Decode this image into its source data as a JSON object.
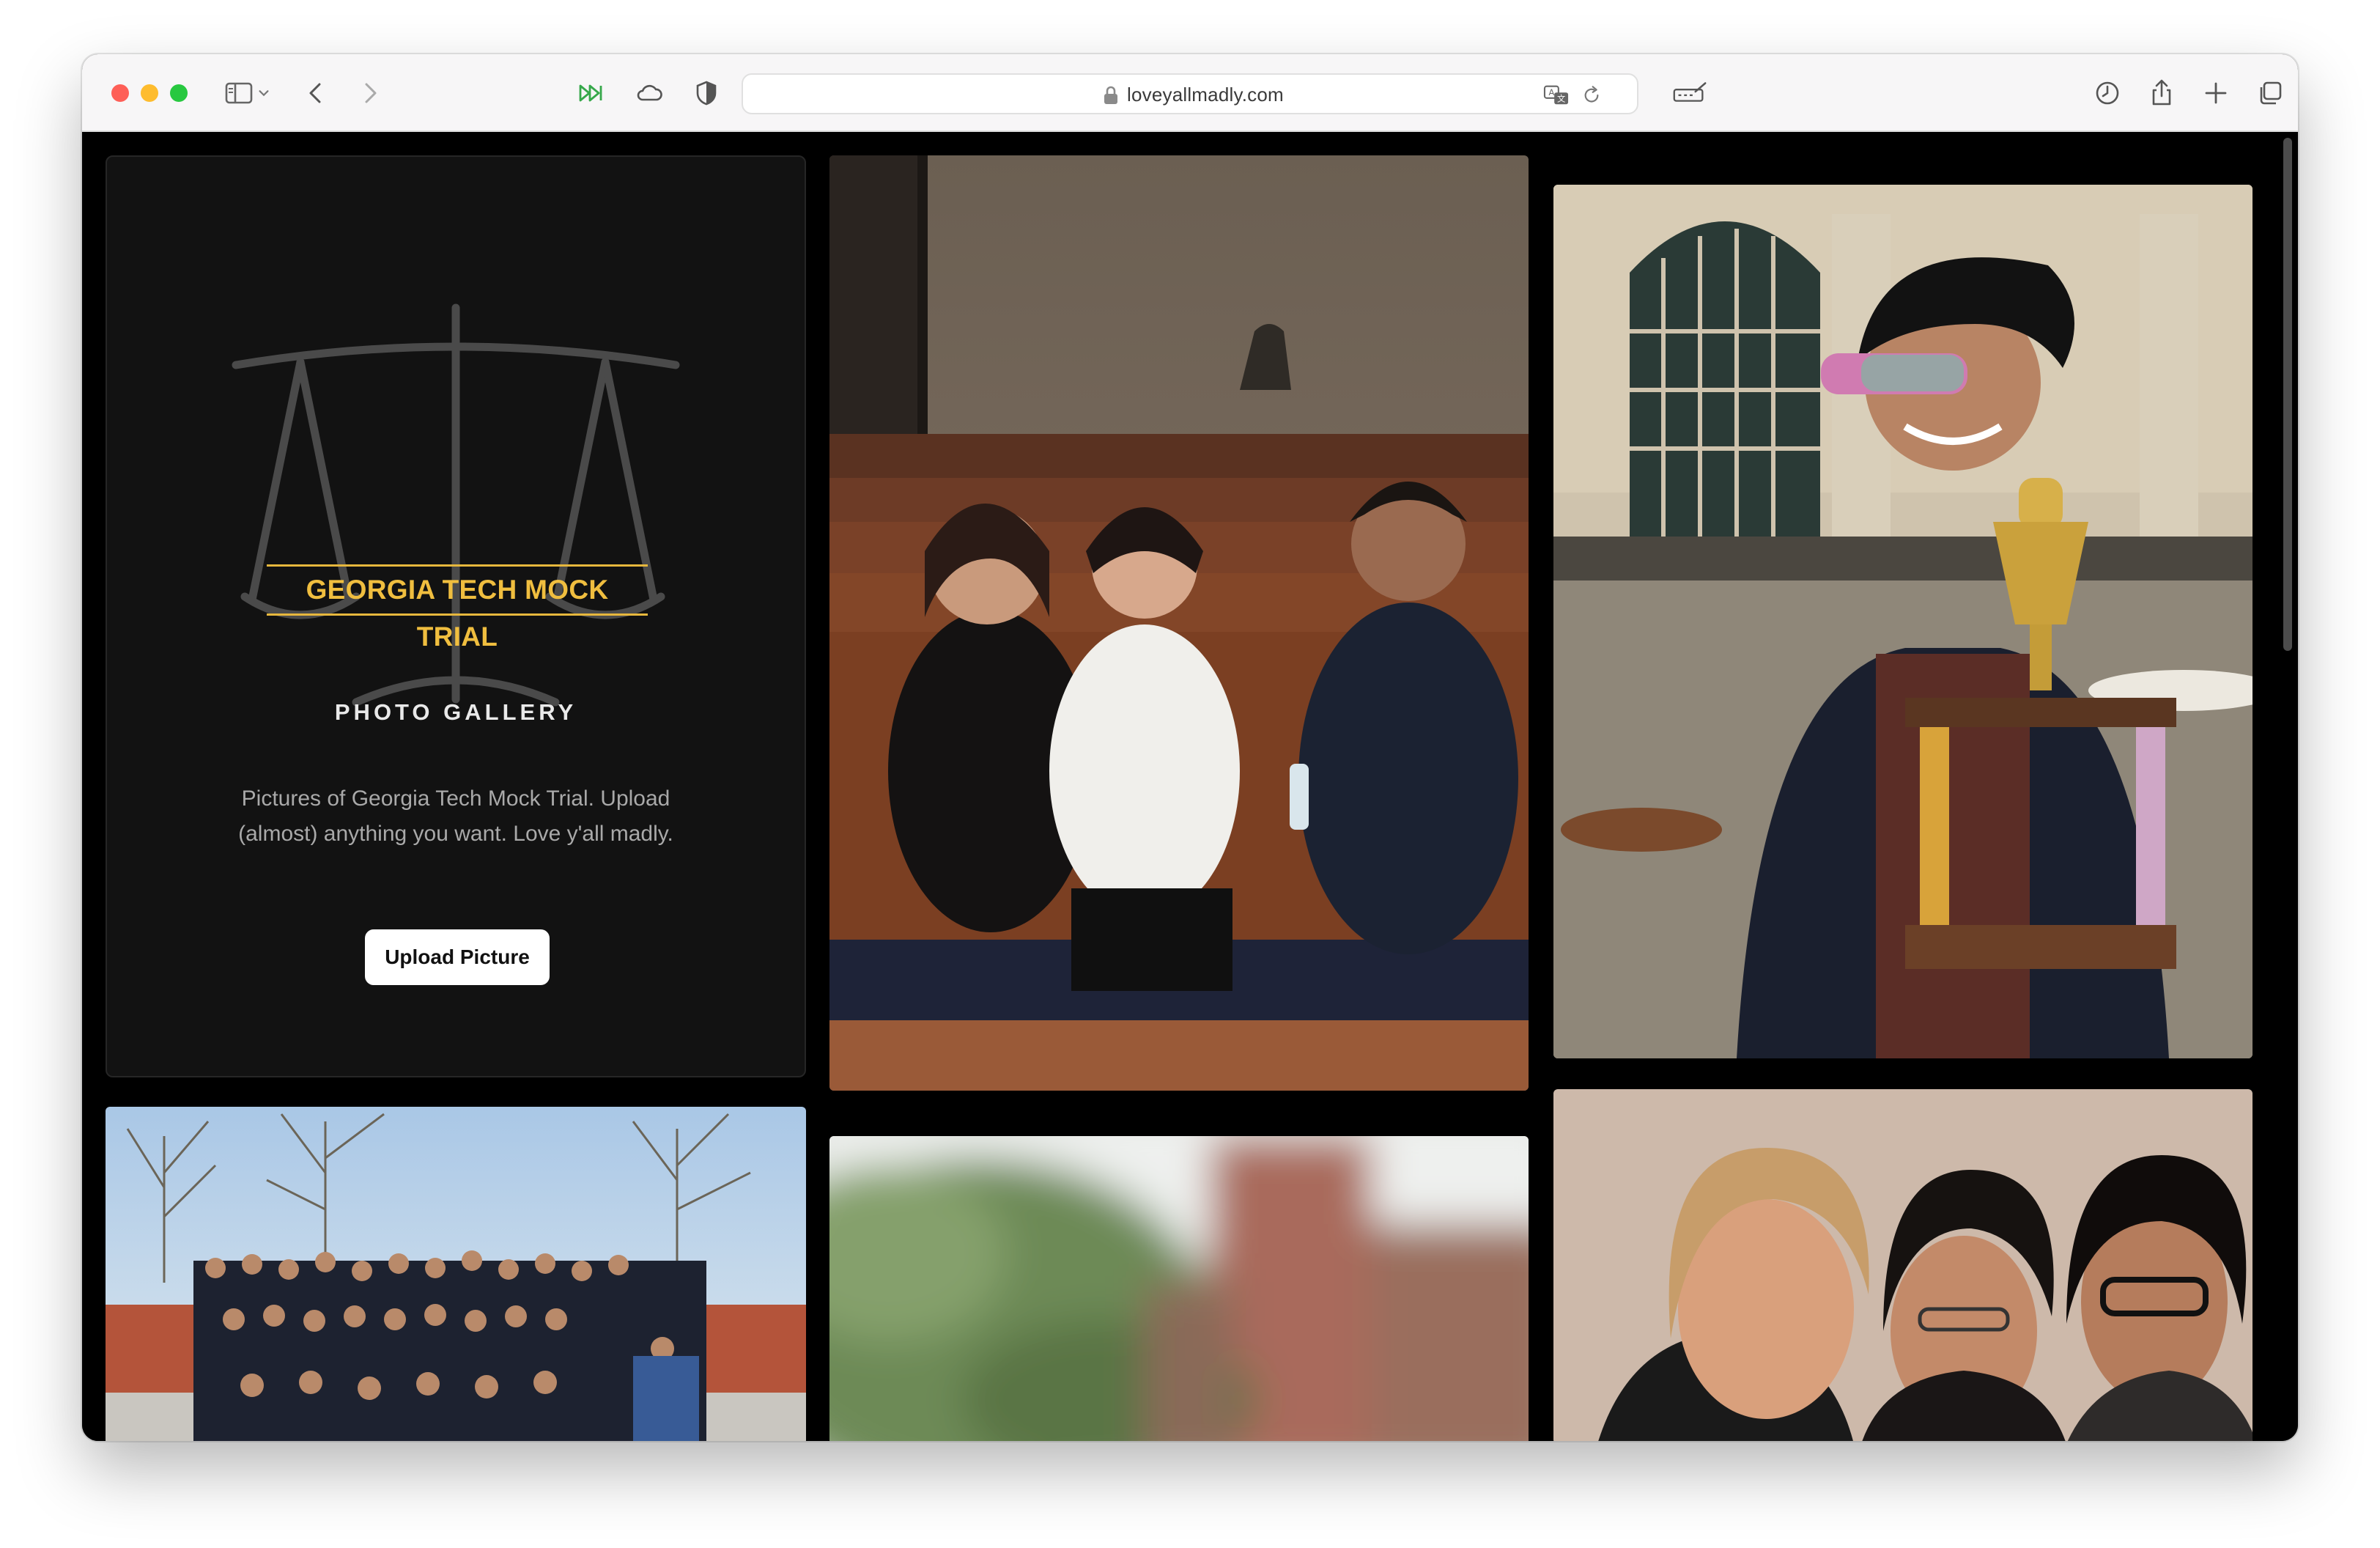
{
  "browser": {
    "url": "loveyallmadly.com",
    "toolbar_icons": [
      "sidebar-icon",
      "chevron-down-icon",
      "back-icon",
      "forward-icon",
      "fast-forward-icon",
      "cloud-icon",
      "shield-icon",
      "translate-icon",
      "reload-icon",
      "reader-icon",
      "history-icon",
      "share-icon",
      "new-tab-icon",
      "tabs-overview-icon"
    ]
  },
  "hero": {
    "title": "GEORGIA TECH MOCK TRIAL",
    "subtitle": "PHOTO GALLERY",
    "description": "Pictures of Georgia Tech Mock Trial. Upload (almost) anything you want. Love y'all madly.",
    "upload_label": "Upload Picture",
    "accent_color": "#f0be3f"
  },
  "photos": [
    {
      "id": "courtroom-friends-photo"
    },
    {
      "id": "trophy-photo"
    },
    {
      "id": "team-group-photo"
    },
    {
      "id": "campus-blur-photo"
    },
    {
      "id": "smiling-friends-photo"
    }
  ]
}
